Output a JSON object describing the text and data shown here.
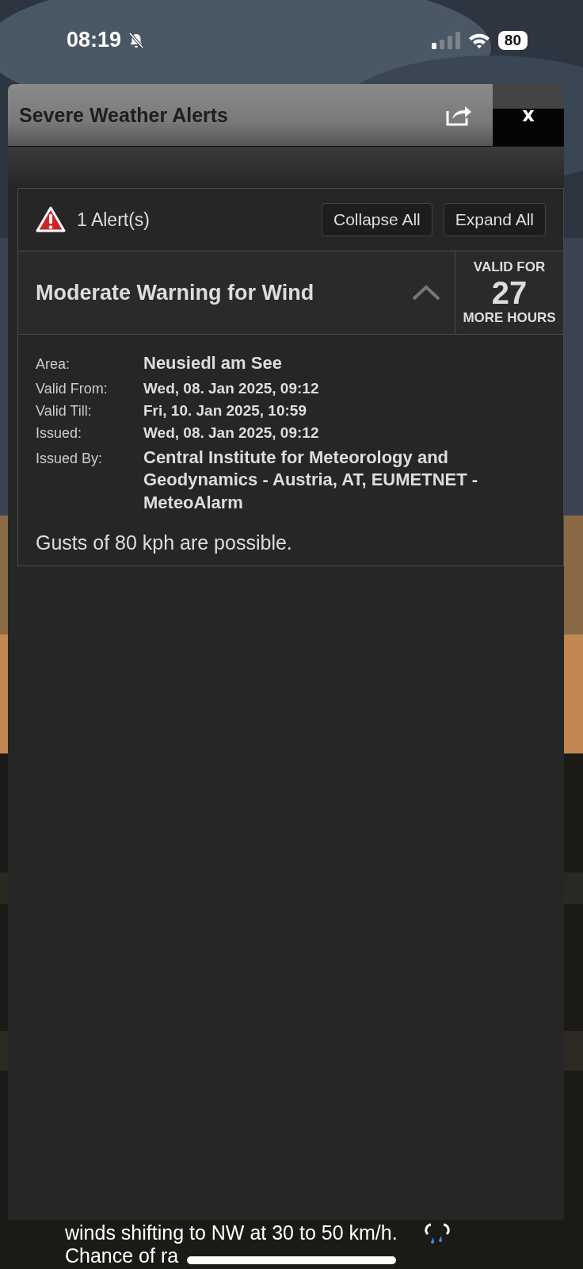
{
  "status_bar": {
    "time": "08:19",
    "silent": true,
    "battery": "80"
  },
  "dialog": {
    "title": "Severe Weather Alerts",
    "close": "x"
  },
  "alerts": {
    "count": "1 Alert(s)",
    "buttons": [
      "Collapse All",
      "Expand All"
    ],
    "items": [
      {
        "title": "Moderate Warning for Wind",
        "expanded": true,
        "valid_top": "VALID FOR",
        "valid_hours": "27",
        "valid_bottom": "MORE HOURS",
        "details": [
          {
            "label": "Area:",
            "value": "Neusiedl am See",
            "kind": "large"
          },
          {
            "label": "Valid From:",
            "value": "Wed, 08. Jan 2025, 09:12",
            "kind": "small"
          },
          {
            "label": "Valid Till:",
            "value": "Fri, 10. Jan 2025, 10:59",
            "kind": "small"
          },
          {
            "label": "Issued:",
            "value": "Wed, 08. Jan 2025,   09:12",
            "kind": "small"
          },
          {
            "label": "Issued By:",
            "value": "Central Institute for Meteorology and Geodynamics - Austria, AT, EUMETNET - MeteoAlarm",
            "kind": "large"
          }
        ],
        "description": "Gusts of 80 kph are possible."
      }
    ]
  },
  "background_forecast": [
    "winds shifting to NW at 30 to 50 km/h.",
    "Chance of ra"
  ]
}
